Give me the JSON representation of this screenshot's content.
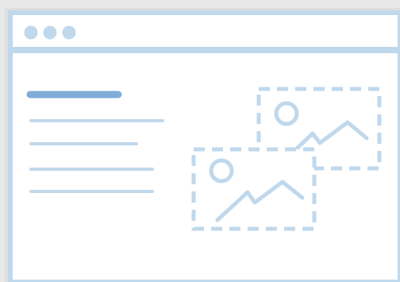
{
  "illustration": {
    "subject": "browser-window-with-text-and-image-placeholders",
    "colors": {
      "background": "#e8e8e8",
      "window_fill": "#ffffff",
      "frame": "#c0d8ec",
      "heading_bar": "#7fadd8",
      "text_lines": "#c0d8ec",
      "placeholders": "#c0d8ec"
    },
    "titlebar_dot_count": 3,
    "text_line_count": 4,
    "image_placeholder_count": 2
  }
}
